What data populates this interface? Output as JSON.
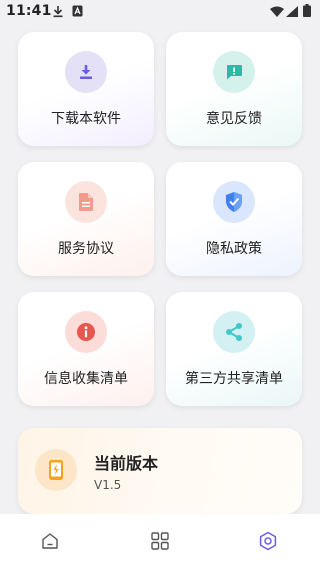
{
  "status_bar": {
    "time": "11:41"
  },
  "cards": [
    {
      "label": "下载本软件"
    },
    {
      "label": "意见反馈"
    },
    {
      "label": "服务协议"
    },
    {
      "label": "隐私政策"
    },
    {
      "label": "信息收集清单"
    },
    {
      "label": "第三方共享清单"
    }
  ],
  "version": {
    "title": "当前版本",
    "value": "V1.5"
  },
  "icons": {
    "download": "download-icon",
    "feedback": "feedback-icon",
    "agreement": "document-icon",
    "privacy": "shield-icon",
    "info": "info-icon",
    "share": "share-icon",
    "version": "phone-icon"
  },
  "colors": {
    "purple": "#6b5ce7",
    "teal": "#2fb8a6",
    "peach": "#f29a8c",
    "blue": "#3f7ff0",
    "red": "#e5574f",
    "cyan": "#41c7c9",
    "orange": "#f5a123",
    "nav_active": "#6b5ce7"
  },
  "bottom_nav": {
    "active": "settings",
    "items": [
      "home-icon",
      "grid-icon",
      "settings-icon"
    ]
  }
}
